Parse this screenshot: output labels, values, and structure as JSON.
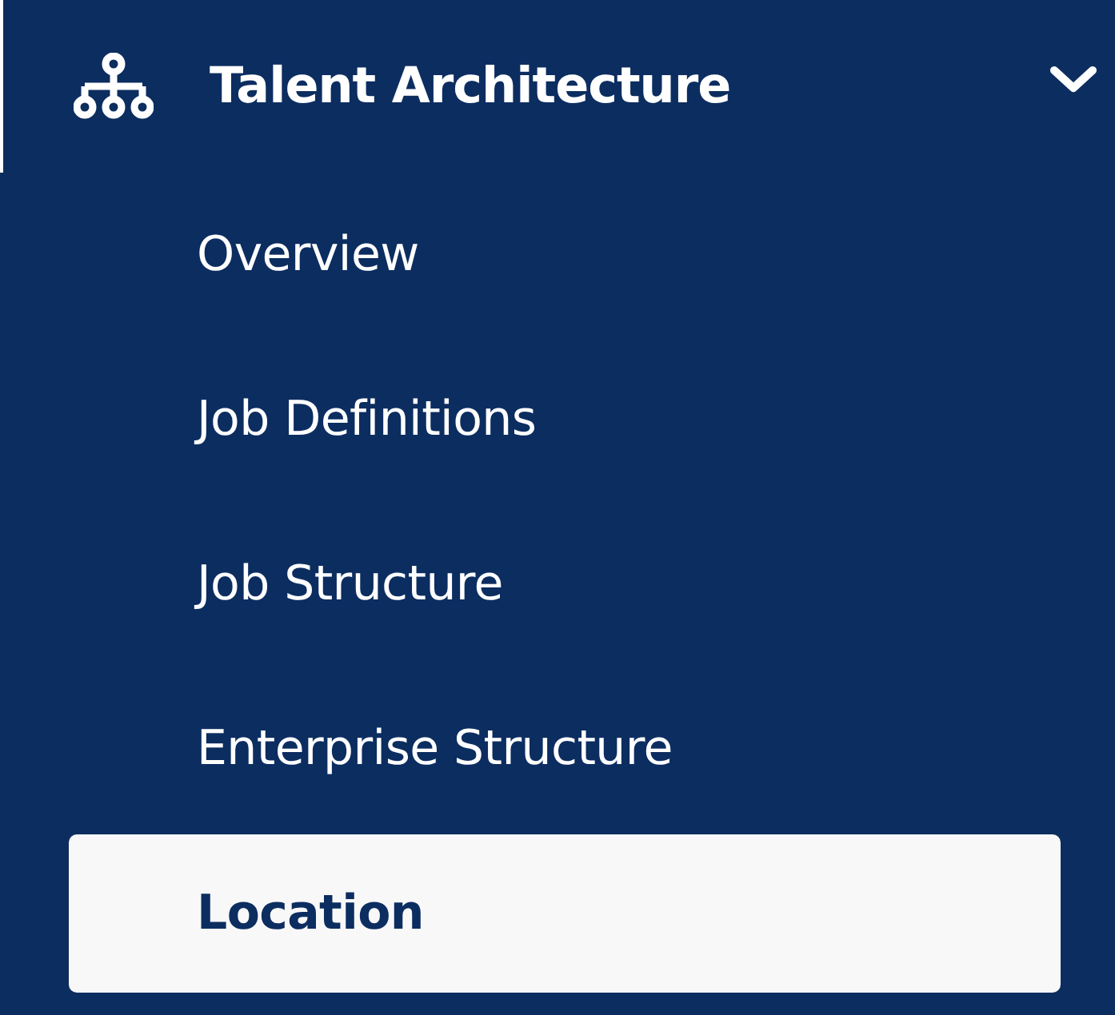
{
  "section": {
    "title": "Talent Architecture",
    "expanded": true
  },
  "items": [
    {
      "label": "Overview",
      "selected": false
    },
    {
      "label": "Job Definitions",
      "selected": false
    },
    {
      "label": "Job Structure",
      "selected": false
    },
    {
      "label": "Enterprise Structure",
      "selected": false
    },
    {
      "label": "Location",
      "selected": true
    }
  ]
}
